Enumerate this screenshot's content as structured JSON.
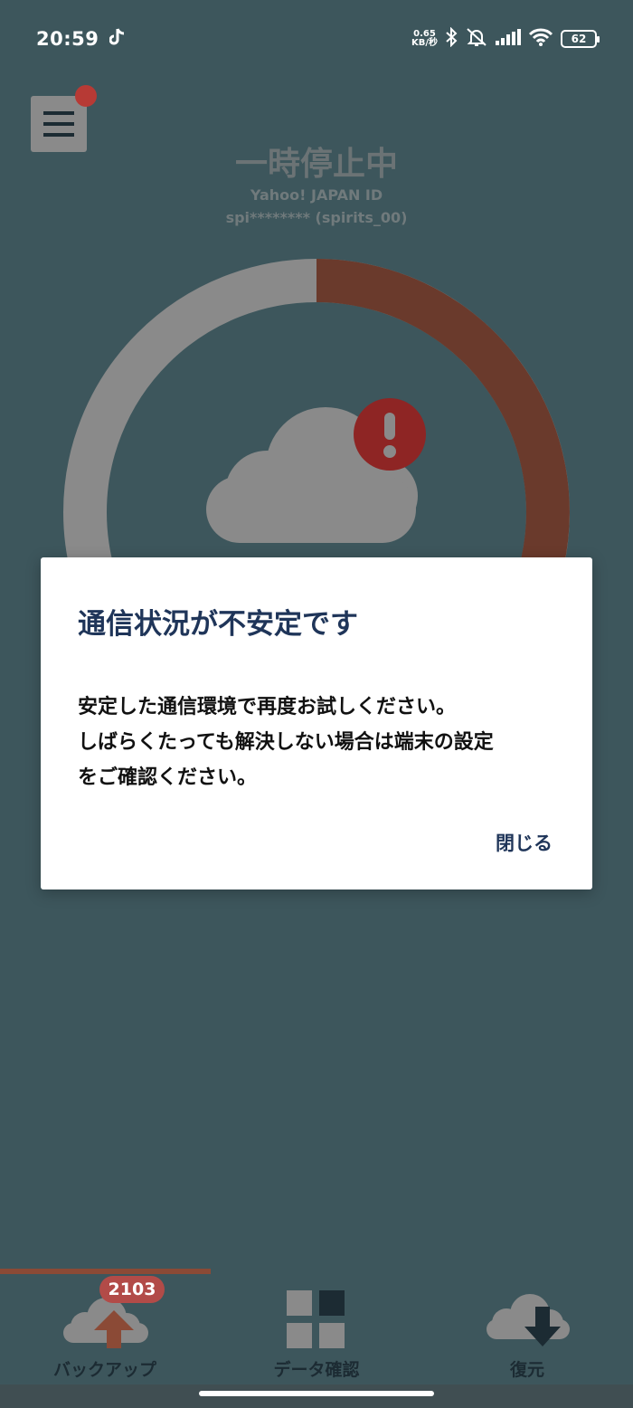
{
  "status_bar": {
    "time": "20:59",
    "net_speed_value": "0.65",
    "net_speed_unit": "KB/秒",
    "battery": "62",
    "icons": [
      "tiktok-icon",
      "bluetooth-icon",
      "mute-icon",
      "signal-icon",
      "wifi-icon",
      "battery-icon"
    ]
  },
  "header": {
    "status_title": "一時停止中",
    "account_label": "Yahoo! JAPAN ID",
    "account_id": "spi******** (spirits_00)"
  },
  "progress_ring": {
    "progress_fraction": 0.38,
    "track_color": "#8a8a8a",
    "progress_color": "#6a3a2c",
    "alert_color": "#8e2524"
  },
  "dialog": {
    "title": "通信状況が不安定です",
    "body_lines": [
      "安定した通信環境で再度お試しください。",
      "しばらくたっても解決しない場合は端末の設定",
      "をご確認ください。"
    ],
    "close_label": "閉じる"
  },
  "bottom_nav": {
    "backup_label": "バックアップ",
    "backup_badge": "2103",
    "data_label": "データ確認",
    "restore_label": "復元"
  },
  "colors": {
    "background": "#3d565c",
    "accent": "#b24b48",
    "dialog_title": "#1f3559"
  }
}
